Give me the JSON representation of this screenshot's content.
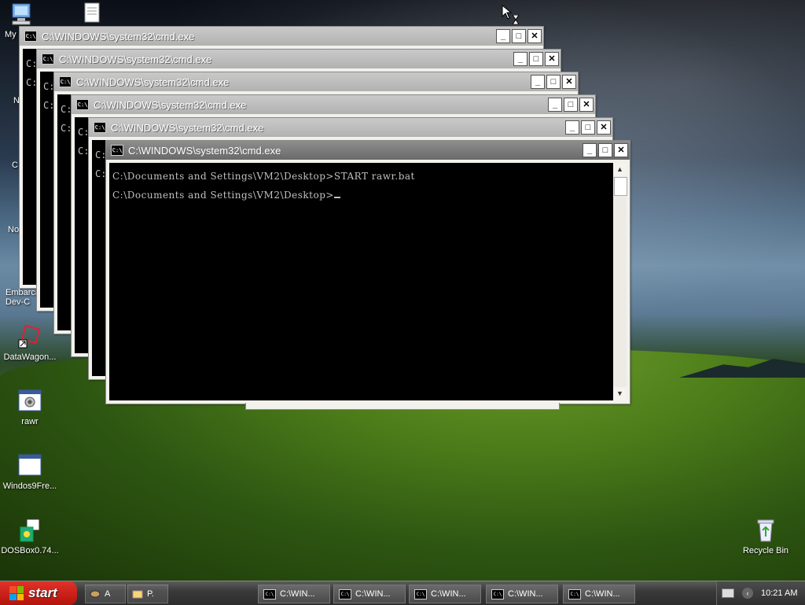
{
  "desktop": {
    "icons": [
      {
        "name": "my-computer-icon",
        "label": "My"
      },
      {
        "name": "document-icon",
        "label": ""
      },
      {
        "name": "embarcadero-icon",
        "label": "Embarca\nDev-C"
      },
      {
        "name": "datawagon-icon",
        "label": "DataWagon..."
      },
      {
        "name": "rawr-icon",
        "label": "rawr"
      },
      {
        "name": "windos9free-icon",
        "label": "Windos9Fre..."
      },
      {
        "name": "dosbox-icon",
        "label": "DOSBox0.74..."
      },
      {
        "name": "recycle-bin-icon",
        "label": "Recycle Bin"
      }
    ],
    "partial_labels": [
      "N",
      "C",
      "No"
    ]
  },
  "window": {
    "title": "C:\\WINDOWS\\system32\\cmd.exe",
    "minimize": "_",
    "maximize": "□",
    "close": "✕",
    "peek_prompt": "C:",
    "console_lines": [
      "C:\\Documents and Settings\\VM2\\Desktop>START rawr.bat",
      "C:\\Documents and Settings\\VM2\\Desktop>"
    ]
  },
  "taskbar": {
    "start_label": "start",
    "quick_items": [
      {
        "label": "A"
      },
      {
        "label": "P."
      }
    ],
    "task_buttons": [
      {
        "label": "C:\\WIN..."
      },
      {
        "label": "C:\\WIN..."
      },
      {
        "label": "C:\\WIN..."
      },
      {
        "label": "C:\\WIN..."
      },
      {
        "label": "C:\\WIN..."
      }
    ],
    "clock": "10:21 AM"
  }
}
